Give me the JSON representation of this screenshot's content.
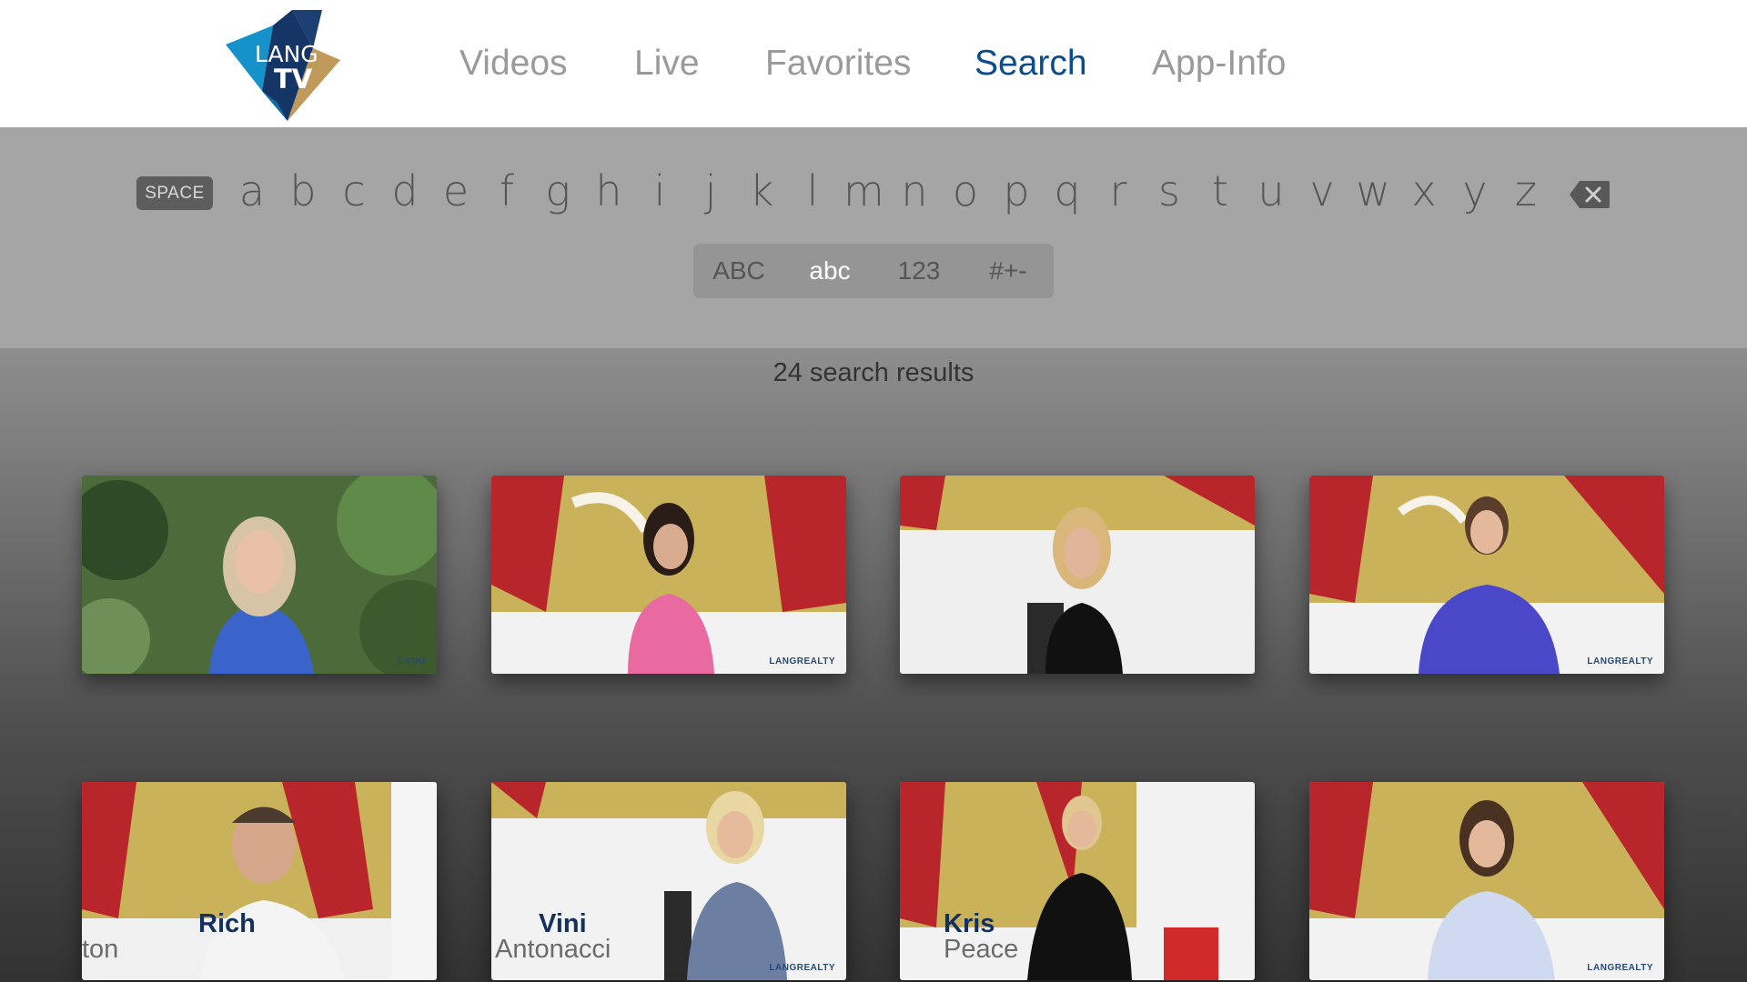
{
  "app": {
    "logo_text_top": "LANG",
    "logo_text_bottom": "TV"
  },
  "nav": {
    "items": [
      {
        "label": "Videos",
        "active": false
      },
      {
        "label": "Live",
        "active": false
      },
      {
        "label": "Favorites",
        "active": false
      },
      {
        "label": "Search",
        "active": true
      },
      {
        "label": "App-Info",
        "active": false
      }
    ]
  },
  "keyboard": {
    "space_label": "SPACE",
    "letters": [
      "a",
      "b",
      "c",
      "d",
      "e",
      "f",
      "g",
      "h",
      "i",
      "j",
      "k",
      "l",
      "m",
      "n",
      "o",
      "p",
      "q",
      "r",
      "s",
      "t",
      "u",
      "v",
      "w",
      "x",
      "y",
      "z"
    ],
    "delete_icon": "backspace-icon",
    "modes": [
      {
        "label": "ABC",
        "active": false
      },
      {
        "label": "abc",
        "active": true
      },
      {
        "label": "123",
        "active": false
      },
      {
        "label": "#+-",
        "active": false
      }
    ]
  },
  "results": {
    "count_label": "24 search results",
    "brand_watermark": "LANGREALTY",
    "tiles": [
      {
        "first": "",
        "last": "",
        "watermark": "LANG"
      },
      {
        "first": "",
        "last": "",
        "watermark": "LANGREALTY"
      },
      {
        "first": "",
        "last": "",
        "watermark": ""
      },
      {
        "first": "",
        "last": "",
        "watermark": "LANGREALTY"
      },
      {
        "first": "Rich",
        "last": "ton",
        "watermark": ""
      },
      {
        "first": "Vini",
        "last": "Antonacci",
        "watermark": "LANGREALTY"
      },
      {
        "first": "Kris",
        "last": "Peace",
        "watermark": ""
      },
      {
        "first": "",
        "last": "",
        "watermark": "LANGREALTY"
      }
    ]
  },
  "colors": {
    "accent": "#0a4c8c",
    "nav_inactive": "#9a9a9a",
    "keyboard_bg": "#a5a5a5"
  }
}
